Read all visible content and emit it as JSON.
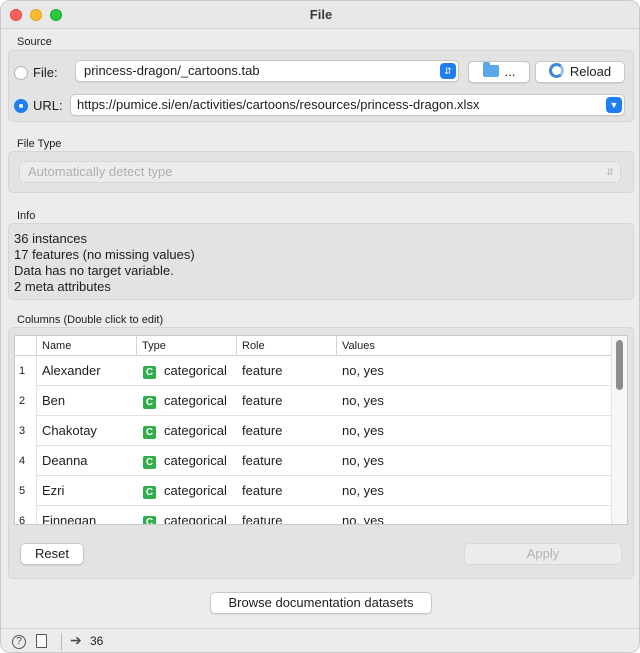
{
  "window": {
    "title": "File"
  },
  "source": {
    "label": "Source",
    "file_label": "File:",
    "file_value": "princess-dragon/_cartoons.tab",
    "browse_label": "...",
    "reload_label": "Reload",
    "url_label": "URL:",
    "url_value": "https://pumice.si/en/activities/cartoons/resources/princess-dragon.xlsx",
    "selected": "url"
  },
  "file_type": {
    "label": "File Type",
    "value": "Automatically detect type"
  },
  "info": {
    "label": "Info",
    "lines": [
      "36 instances",
      "17 features (no missing values)",
      "Data has no target variable.",
      "2 meta attributes"
    ]
  },
  "columns": {
    "label": "Columns (Double click to edit)",
    "headers": [
      "Name",
      "Type",
      "Role",
      "Values"
    ],
    "rows": [
      {
        "num": "1",
        "name": "Alexander",
        "type_badge": "C",
        "type": "categorical",
        "role": "feature",
        "values": "no, yes"
      },
      {
        "num": "2",
        "name": "Ben",
        "type_badge": "C",
        "type": "categorical",
        "role": "feature",
        "values": "no, yes"
      },
      {
        "num": "3",
        "name": "Chakotay",
        "type_badge": "C",
        "type": "categorical",
        "role": "feature",
        "values": "no, yes"
      },
      {
        "num": "4",
        "name": "Deanna",
        "type_badge": "C",
        "type": "categorical",
        "role": "feature",
        "values": "no, yes"
      },
      {
        "num": "5",
        "name": "Ezri",
        "type_badge": "C",
        "type": "categorical",
        "role": "feature",
        "values": "no, yes"
      },
      {
        "num": "6",
        "name": "Finnegan",
        "type_badge": "C",
        "type": "categorical",
        "role": "feature",
        "values": "no, yes"
      }
    ]
  },
  "buttons": {
    "reset": "Reset",
    "apply": "Apply",
    "browse_docs": "Browse documentation datasets"
  },
  "statusbar": {
    "help_icon": "?",
    "output_count": "36"
  },
  "colors": {
    "accent": "#1f7ef4",
    "categorical_badge": "#2fae4a"
  }
}
